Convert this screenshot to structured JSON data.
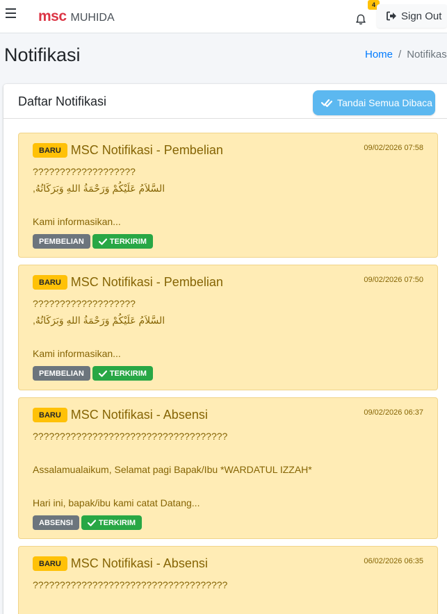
{
  "navbar": {
    "brand_logo": "msc",
    "brand_name": "MUHIDA",
    "notification_count": "4",
    "signout_label": "Sign Out"
  },
  "page": {
    "title": "Notifikasi",
    "breadcrumb_home": "Home",
    "breadcrumb_sep": "/",
    "breadcrumb_current": "Notifikasi"
  },
  "card": {
    "title": "Daftar Notifikasi",
    "mark_all_label": "Tandai Semua Dibaca"
  },
  "colors": {
    "notif_bg": "#ffecb5",
    "badge_new": "#ffc107",
    "tag_category": "#6c757d",
    "tag_status": "#28a745",
    "mark_all_button": "#5cb8f0",
    "brand_logo": "#dc3545"
  },
  "notifications": [
    {
      "badge": "BARU",
      "title": "MSC Notifikasi - Pembelian",
      "date": "09/02/2026 07:58",
      "body_line1": "???????????????????",
      "body_line2": "السَّلاَمُ عَلَيْكُمْ وَرَحْمَةُ اللهِ وَبَرَكَاتُهُ,",
      "body_line3": "Kami informasikan...",
      "category": "PEMBELIAN",
      "status": "TERKIRIM"
    },
    {
      "badge": "BARU",
      "title": "MSC Notifikasi - Pembelian",
      "date": "09/02/2026 07:50",
      "body_line1": "???????????????????",
      "body_line2": "السَّلاَمُ عَلَيْكُمْ وَرَحْمَةُ اللهِ وَبَرَكَاتُهُ,",
      "body_line3": "Kami informasikan...",
      "category": "PEMBELIAN",
      "status": "TERKIRIM"
    },
    {
      "badge": "BARU",
      "title": "MSC Notifikasi - Absensi",
      "date": "09/02/2026 06:37",
      "body_line1": "????????????????????????????????????",
      "body_line2": "Assalamualaikum, Selamat pagi Bapak/Ibu *WARDATUL IZZAH*",
      "body_line3": "Hari ini, bapak/ibu kami catat Datang...",
      "category": "ABSENSI",
      "status": "TERKIRIM"
    },
    {
      "badge": "BARU",
      "title": "MSC Notifikasi - Absensi",
      "date": "06/02/2026 06:35",
      "body_line1": "????????????????????????????????????"
    }
  ]
}
